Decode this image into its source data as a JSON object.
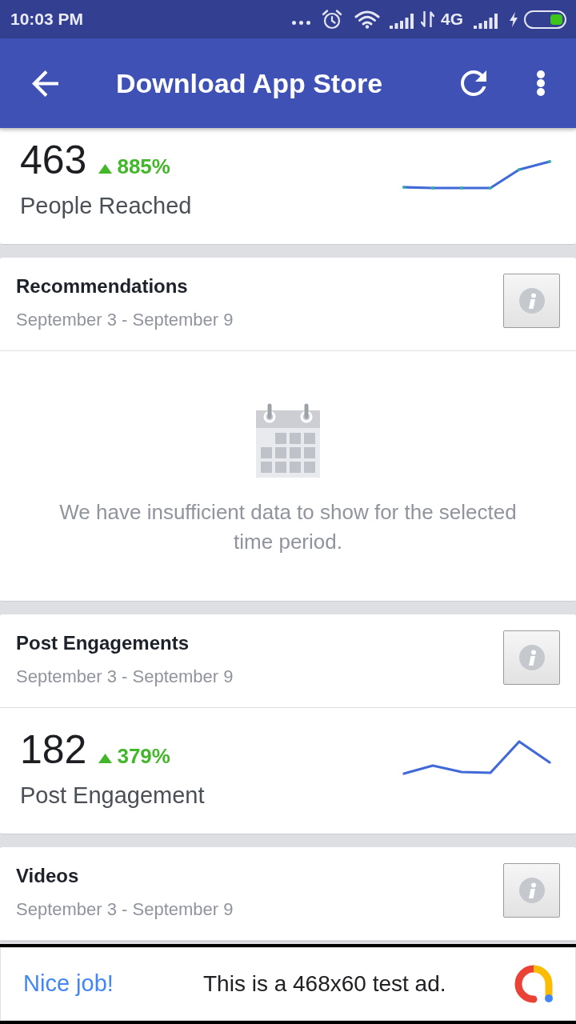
{
  "status_bar": {
    "time": "10:03 PM",
    "network_type": "4G"
  },
  "app_bar": {
    "title": "Download App Store"
  },
  "cards": [
    {
      "kind": "metric",
      "value": "463",
      "change": "885%",
      "label": "People Reached"
    },
    {
      "kind": "section",
      "title": "Recommendations",
      "date_range": "September 3 - September 9",
      "empty_message": "We have insufficient data to show for the selected time period."
    },
    {
      "kind": "section",
      "title": "Post Engagements",
      "date_range": "September 3 - September 9",
      "metric": {
        "value": "182",
        "change": "379%",
        "label": "Post Engagement"
      }
    },
    {
      "kind": "section",
      "title": "Videos",
      "date_range": "September 3 - September 9"
    }
  ],
  "ad_banner": {
    "headline": "Nice job!",
    "text": "This is a 468x60 test ad."
  }
}
